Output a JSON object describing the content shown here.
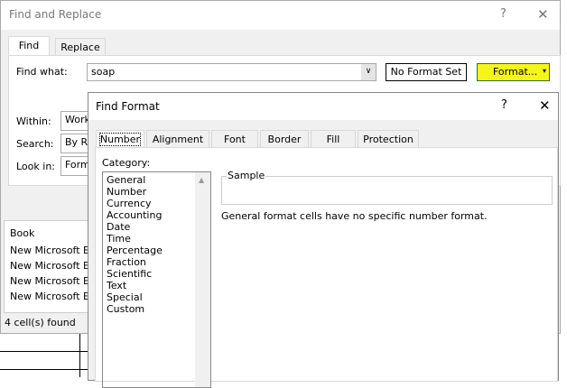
{
  "find_replace": {
    "title": "Find and Replace",
    "help": "?",
    "close": "✕",
    "tabs": [
      "Find",
      "Replace"
    ],
    "find_what_label": "Find what:",
    "find_what_value": "soap",
    "no_format_label": "No Format Set",
    "format_button": "Format...",
    "within_label": "Within:",
    "within_value": "Work",
    "search_label": "Search:",
    "search_value": "By Ro",
    "lookin_label": "Look in:",
    "lookin_value": "Form",
    "results_header": "Book",
    "results": [
      "New Microsoft Ex",
      "New Microsoft Ex",
      "New Microsoft Ex",
      "New Microsoft Ex"
    ],
    "status": "4 cell(s) found"
  },
  "find_format": {
    "title": "Find Format",
    "help": "?",
    "close": "✕",
    "tabs": [
      "Number",
      "Alignment",
      "Font",
      "Border",
      "Fill",
      "Protection"
    ],
    "category_label": "Category:",
    "categories": [
      "General",
      "Number",
      "Currency",
      "Accounting",
      "Date",
      "Time",
      "Percentage",
      "Fraction",
      "Scientific",
      "Text",
      "Special",
      "Custom"
    ],
    "sample_label": "Sample",
    "description": "General format cells have no specific number format."
  }
}
